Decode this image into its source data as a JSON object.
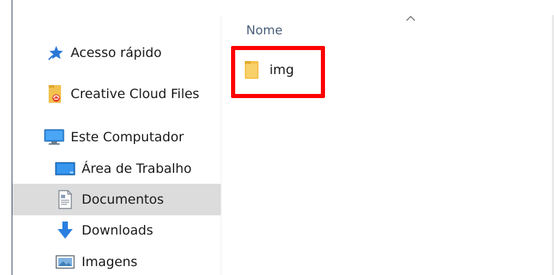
{
  "navigation": {
    "items": [
      {
        "label": "Acesso rápido",
        "icon": "star-pin-icon"
      },
      {
        "label": "Creative Cloud Files",
        "icon": "creative-cloud-folder-icon"
      },
      {
        "label": "Este Computador",
        "icon": "computer-icon"
      },
      {
        "label": "Área de Trabalho",
        "icon": "desktop-icon"
      },
      {
        "label": "Documentos",
        "icon": "documents-icon",
        "selected": true
      },
      {
        "label": "Downloads",
        "icon": "download-arrow-icon"
      },
      {
        "label": "Imagens",
        "icon": "pictures-icon"
      }
    ]
  },
  "content": {
    "column_header": "Nome",
    "files": [
      {
        "name": "img",
        "type": "folder",
        "icon": "folder-icon"
      }
    ]
  },
  "colors": {
    "selection": "#dcdcdc",
    "highlight": "#ff0000",
    "header_text": "#4c607a"
  }
}
